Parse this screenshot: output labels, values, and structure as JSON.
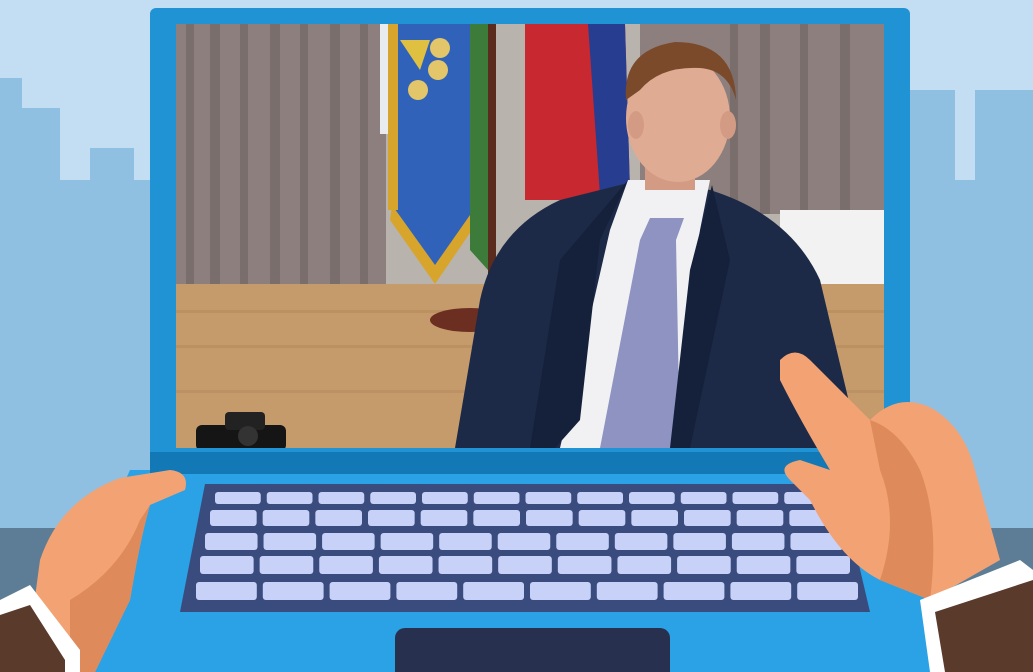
{
  "scene": {
    "description_alt": "",
    "colors": {
      "sky": "#c3def3",
      "buildings": "#8fbfe1",
      "ground": "#5c7d95",
      "laptop_frame": "#1f93d4",
      "laptop_frame_dark": "#1279b6",
      "laptop_base": "#2ba1e6",
      "keyboard_bg": "#3a4b7d",
      "keys": "#c8d1f7",
      "touchpad": "#27314f",
      "skin": "#f3a273",
      "skin_shadow": "#df8a5a",
      "sleeve": "#5a3a2b",
      "cuff": "#ffffff",
      "curtain": "#8c7f7e",
      "floor": "#c59b6c",
      "suit": "#1c2a47",
      "tie": "#8e93c2",
      "shirt": "#f1f1f3",
      "flag_blue": "#2f62b8",
      "flag_red": "#c8282f",
      "flag_gold": "#d7a52c"
    },
    "icons": {
      "left_hand": "hand-icon",
      "right_hand": "pointing-hand-icon",
      "camera": "camera-icon"
    }
  }
}
